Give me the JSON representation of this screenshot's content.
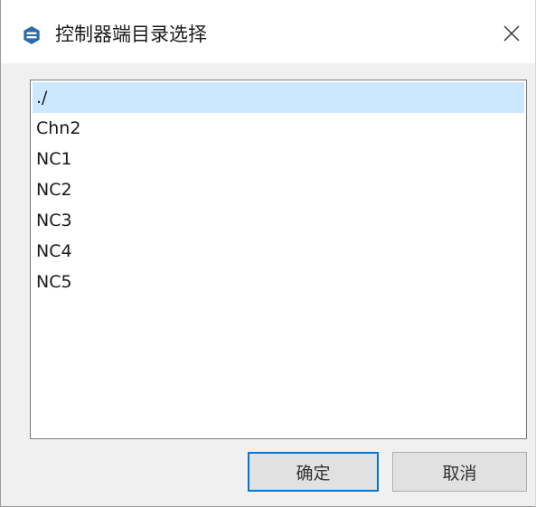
{
  "window": {
    "title": "控制器端目录选择",
    "icon": "app-logo-icon",
    "close_icon": "close-icon"
  },
  "directory_list": {
    "items": [
      {
        "label": "./",
        "selected": true
      },
      {
        "label": "Chn2",
        "selected": false
      },
      {
        "label": "NC1",
        "selected": false
      },
      {
        "label": "NC2",
        "selected": false
      },
      {
        "label": "NC3",
        "selected": false
      },
      {
        "label": "NC4",
        "selected": false
      },
      {
        "label": "NC5",
        "selected": false
      }
    ]
  },
  "buttons": {
    "ok_label": "确定",
    "cancel_label": "取消"
  },
  "colors": {
    "selection": "#cce8ff",
    "accent": "#0078d7",
    "app_icon": "#2b6cb0",
    "dialog_background": "#f0f0f0"
  }
}
